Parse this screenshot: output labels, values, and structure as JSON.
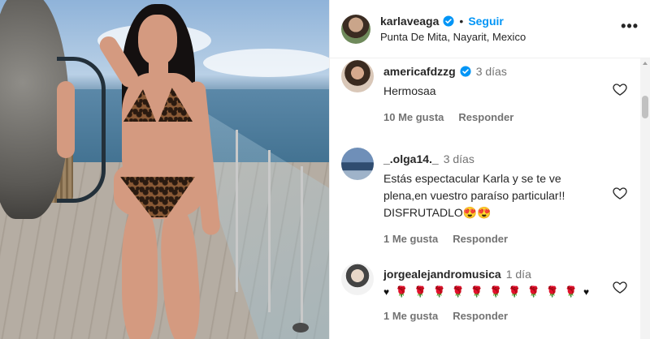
{
  "post": {
    "photo_alt": "Post image"
  },
  "header": {
    "username": "karlaveaga",
    "separator": "•",
    "follow_label": "Seguir",
    "location": "Punta De Mita, Nayarit, Mexico",
    "more_label": "•••"
  },
  "comments": [
    {
      "username": "americafdzzg",
      "verified": true,
      "time": "3 días",
      "text": "Hermosaa",
      "likes": "10 Me gusta",
      "reply": "Responder"
    },
    {
      "username": "_.olga14._",
      "verified": false,
      "time": "3 días",
      "text": "Estás espectacular Karla y se te ve plena,en vuestro paraíso particular!! DISFRUTADLO😍😍",
      "likes": "1 Me gusta",
      "reply": "Responder"
    },
    {
      "username": "jorgealejandromusica",
      "verified": false,
      "time": "1 día",
      "emoji_sequence": [
        "♥",
        "🌹",
        "🌹",
        "🌹",
        "🌹",
        "🌹",
        "🌹",
        "🌹",
        "🌹",
        "🌹",
        "🌹",
        "♥"
      ],
      "likes": "1 Me gusta",
      "reply": "Responder"
    }
  ],
  "colors": {
    "accent": "#0095f6",
    "text": "#262626",
    "muted": "#737373",
    "border": "#efefef"
  }
}
